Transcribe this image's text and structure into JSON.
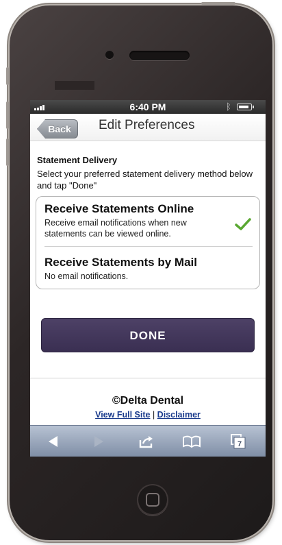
{
  "status_bar": {
    "time": "6:40 PM",
    "signal_icon": "signal-bars-icon",
    "bluetooth_icon": "bluetooth-icon",
    "battery_icon": "battery-icon"
  },
  "nav": {
    "back_label": "Back",
    "title": "Edit Preferences"
  },
  "intro": {
    "heading": "Statement Delivery",
    "text": "Select your preferred statement delivery method below and tap \"Done\""
  },
  "options": [
    {
      "title": "Receive Statements Online",
      "description": "Receive email notifications when new statements can be viewed online.",
      "selected": true
    },
    {
      "title": "Receive Statements by Mail",
      "description": "No email notifications.",
      "selected": false
    }
  ],
  "done_label": "DONE",
  "footer": {
    "copyright": "©Delta Dental",
    "link_full_site": "View Full Site",
    "separator": "|",
    "link_disclaimer": "Disclaimer"
  },
  "toolbar": {
    "tabs_count": "7",
    "icons": [
      "back-arrow-icon",
      "forward-arrow-icon",
      "share-icon",
      "bookmarks-icon",
      "tabs-icon"
    ]
  },
  "colors": {
    "accent": "#3f3458",
    "check": "#5aa832",
    "link": "#1a3b8c",
    "toolbar": "#8e9cb3"
  }
}
